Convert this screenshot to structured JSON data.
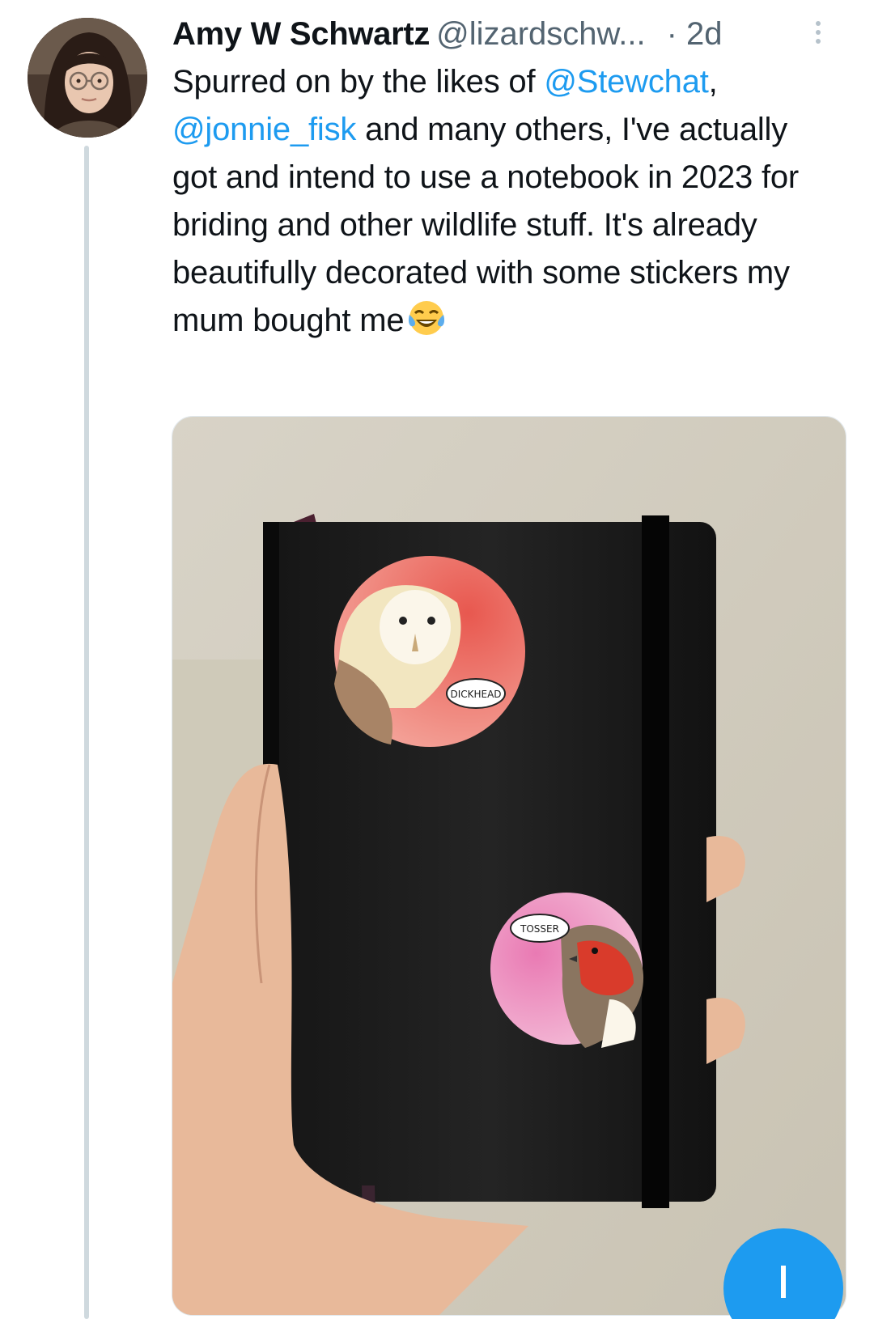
{
  "tweet": {
    "author_name": "Amy W Schwartz",
    "author_handle": "@lizardschw...",
    "time_separator": "·",
    "time_ago": "2d",
    "text": {
      "p1": "Spurred on by the likes of ",
      "mention1": "@Stewchat",
      "p2": ",",
      "mention2": "@jonnie_fisk",
      "p3": " and many others, I've actually got and intend to use a notebook in 2023 for briding and other wildlife stuff. It's already beautifully decorated with some stickers my mum bought me",
      "emoji_name": "face-with-tears-of-joy"
    },
    "media": {
      "owl_sticker_text": "DICKHEAD",
      "robin_sticker_text": "TOSSER"
    }
  },
  "colors": {
    "link": "#1d9bf0",
    "text": "#0f1419",
    "muted": "#536471",
    "thread_line": "#cfd9de"
  },
  "icons": {
    "more": "more-vertical-icon",
    "compose": "compose-fab-icon"
  }
}
